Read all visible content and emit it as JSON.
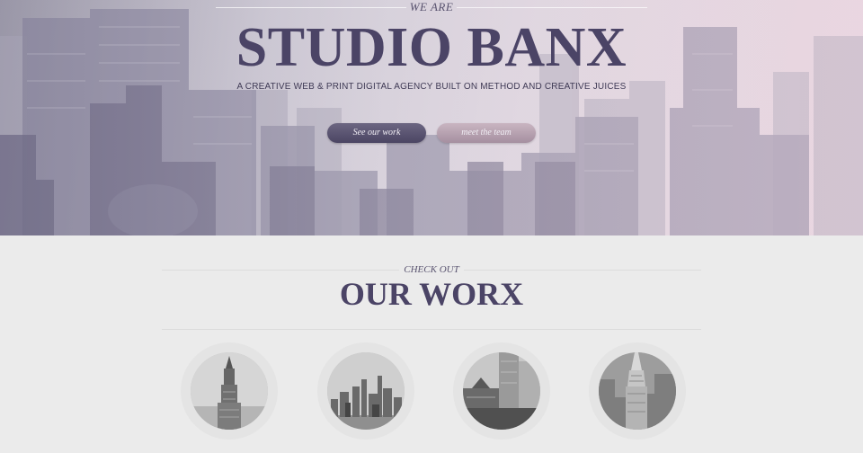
{
  "hero": {
    "eyebrow": "WE ARE",
    "title": "STUDIO BANX",
    "subtitle": "A CREATIVE WEB & PRINT DIGITAL AGENCY BUILT ON METHOD AND CREATIVE JUICES",
    "buttons": {
      "work_label": "See our work",
      "team_label": "meet the team"
    },
    "background": "city-skyline-photo"
  },
  "work": {
    "eyebrow": "CHECK OUT",
    "title": "OUR WORX",
    "thumbnails": [
      {
        "subject": "tower-photo"
      },
      {
        "subject": "skyline-photo"
      },
      {
        "subject": "buildings-photo"
      },
      {
        "subject": "chrysler-photo"
      }
    ]
  },
  "colors": {
    "primary": "#4b4466",
    "accent_pink": "#b8a2b2",
    "background": "#ebebeb"
  }
}
